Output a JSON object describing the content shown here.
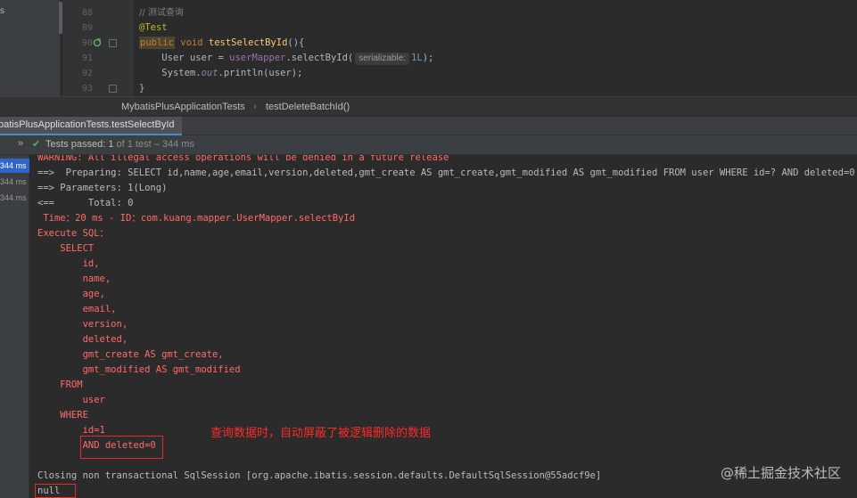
{
  "left_panel": {
    "fragment": "s"
  },
  "editor": {
    "lines": [
      {
        "num": "88"
      },
      {
        "num": "89"
      },
      {
        "num": "90"
      },
      {
        "num": "91"
      },
      {
        "num": "92"
      },
      {
        "num": "93"
      }
    ],
    "comment": "// 测试查询",
    "annotation": "@Test",
    "kw_public": "public",
    "kw_void": "void",
    "method_name": "testSelectById",
    "paren_open": "(){",
    "line91_a": "User user = ",
    "line91_field": "userMapper",
    "line91_b": ".selectById(",
    "param_hint": "serializable:",
    "line91_num": "1L",
    "line91_c": ");",
    "line92_a": "System.",
    "line92_static": "out",
    "line92_b": ".println(user);",
    "closing_brace": "}"
  },
  "breadcrumb": {
    "class": "MybatisPlusApplicationTests",
    "separator": "›",
    "method": "testDeleteBatchId()"
  },
  "run_tab": {
    "label": "batisPlusApplicationTests.testSelectById"
  },
  "test_status": {
    "chevron": "»",
    "passed": "Tests passed: ",
    "count": "1",
    "rest": " of 1 test – 344 ms"
  },
  "tree": [
    {
      "label": "344 ms",
      "selected": true
    },
    {
      "label": "344 ms",
      "selected": false
    },
    {
      "label": "344 ms",
      "selected": false
    }
  ],
  "console": {
    "warning": "WARNING: All illegal access operations will be denied in a future release",
    "preparing": "==>  Preparing: SELECT id,name,age,email,version,deleted,gmt_create AS gmt_create,gmt_modified AS gmt_modified FROM user WHERE id=? AND deleted=0",
    "parameters": "==> Parameters: 1(Long)",
    "total": "<==      Total: 0",
    "time": " Time：20 ms - ID：com.kuang.mapper.UserMapper.selectById",
    "exec": "Execute SQL：",
    "sql_lines": [
      "    SELECT",
      "        id,",
      "        name,",
      "        age,",
      "        email,",
      "        version,",
      "        deleted,",
      "        gmt_create AS gmt_create,",
      "        gmt_modified AS gmt_modified",
      "    FROM",
      "        user",
      "    WHERE",
      "        id=1",
      "        AND deleted=0"
    ],
    "closing": "Closing non transactional SqlSession [org.apache.ibatis.session.defaults.DefaultSqlSession@55adcf9e]",
    "result": "null"
  },
  "annotation_note": "查询数据时，自动屏蔽了被逻辑删除的数据",
  "watermark": "@稀土掘金技术社区"
}
